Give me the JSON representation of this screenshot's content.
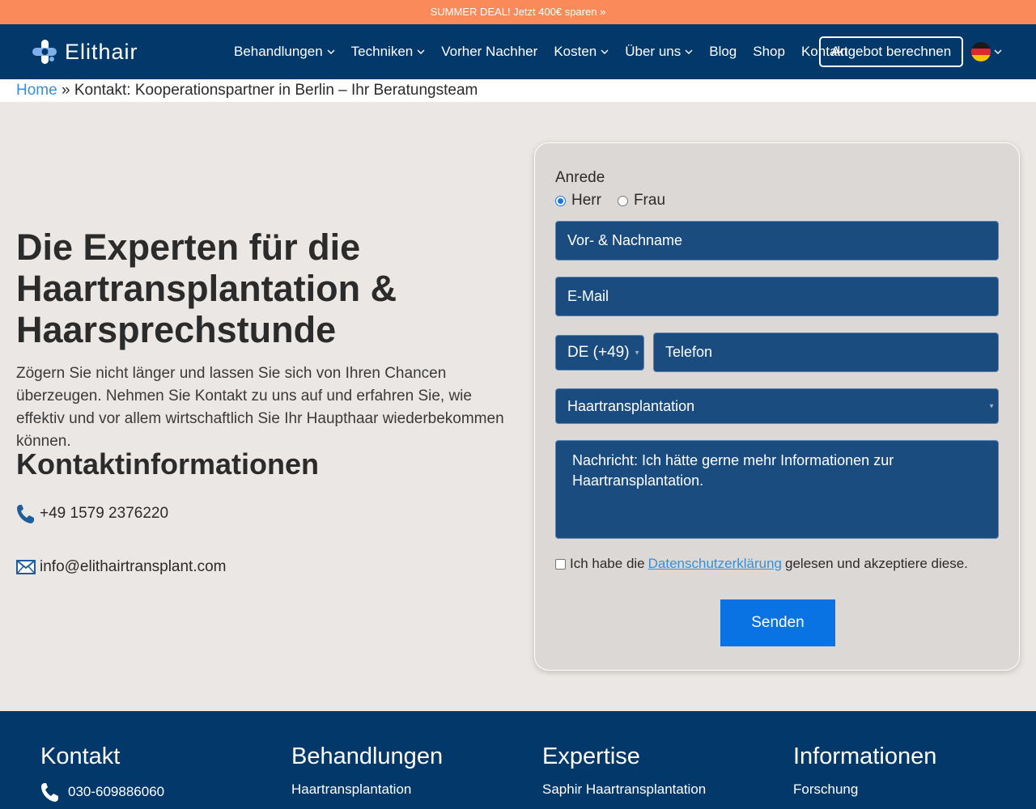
{
  "promo": {
    "text": "SUMMER DEAL! Jetzt 400€ sparen »"
  },
  "brand": {
    "name": "Elithair"
  },
  "nav": {
    "items": [
      "Behandlungen",
      "Techniken",
      "Vorher Nachher",
      "Kosten",
      "Über uns",
      "Blog",
      "Shop",
      "Kontakt"
    ],
    "cta": "Angebot berechnen"
  },
  "breadcrumb": {
    "home": "Home",
    "separator": "»",
    "current": "Kontakt: Kooperationspartner in Berlin – Ihr Beratungsteam"
  },
  "hero": {
    "title": "Die Experten für die Haartransplantation & Haarsprechstunde",
    "text": "Zögern Sie nicht länger und lassen Sie sich von Ihren Chancen überzeugen. Nehmen Sie Kontakt zu uns auf und erfahren Sie, wie effektiv und vor allem wirtschaftlich Sie Ihr Haupthaar wiederbekommen können."
  },
  "contact_info": {
    "heading": "Kontaktinformationen",
    "phone": "+49 1579 2376220",
    "email": "info@elithairtransplant.com"
  },
  "form": {
    "salutation_label": "Anrede",
    "salutation_options": [
      "Herr",
      "Frau"
    ],
    "selected_salutation": "Herr",
    "name_placeholder": "Vor- & Nachname",
    "email_placeholder": "E-Mail",
    "country_code": "DE (+49)",
    "phone_placeholder": "Telefon",
    "treatment": "Haartransplantation",
    "message": "Nachricht: Ich hätte gerne mehr Informationen zur Haartransplantation.",
    "consent_before": "Ich habe die",
    "consent_link": "Datenschutzerklärung",
    "consent_after": "gelesen und akzeptiere diese.",
    "submit": "Senden"
  },
  "footer": {
    "col1": {
      "heading": "Kontakt",
      "item": "030-609886060"
    },
    "col2": {
      "heading": "Behandlungen",
      "item": "Haartransplantation"
    },
    "col3": {
      "heading": "Expertise",
      "item": "Saphir Haartransplantation"
    },
    "col4": {
      "heading": "Informationen",
      "item": "Forschung"
    }
  },
  "colors": {
    "promo": "#fb8a5a",
    "navbar": "#03386b",
    "field": "#1b4c80",
    "button": "#0a73e3",
    "link": "#3a8fd4"
  }
}
